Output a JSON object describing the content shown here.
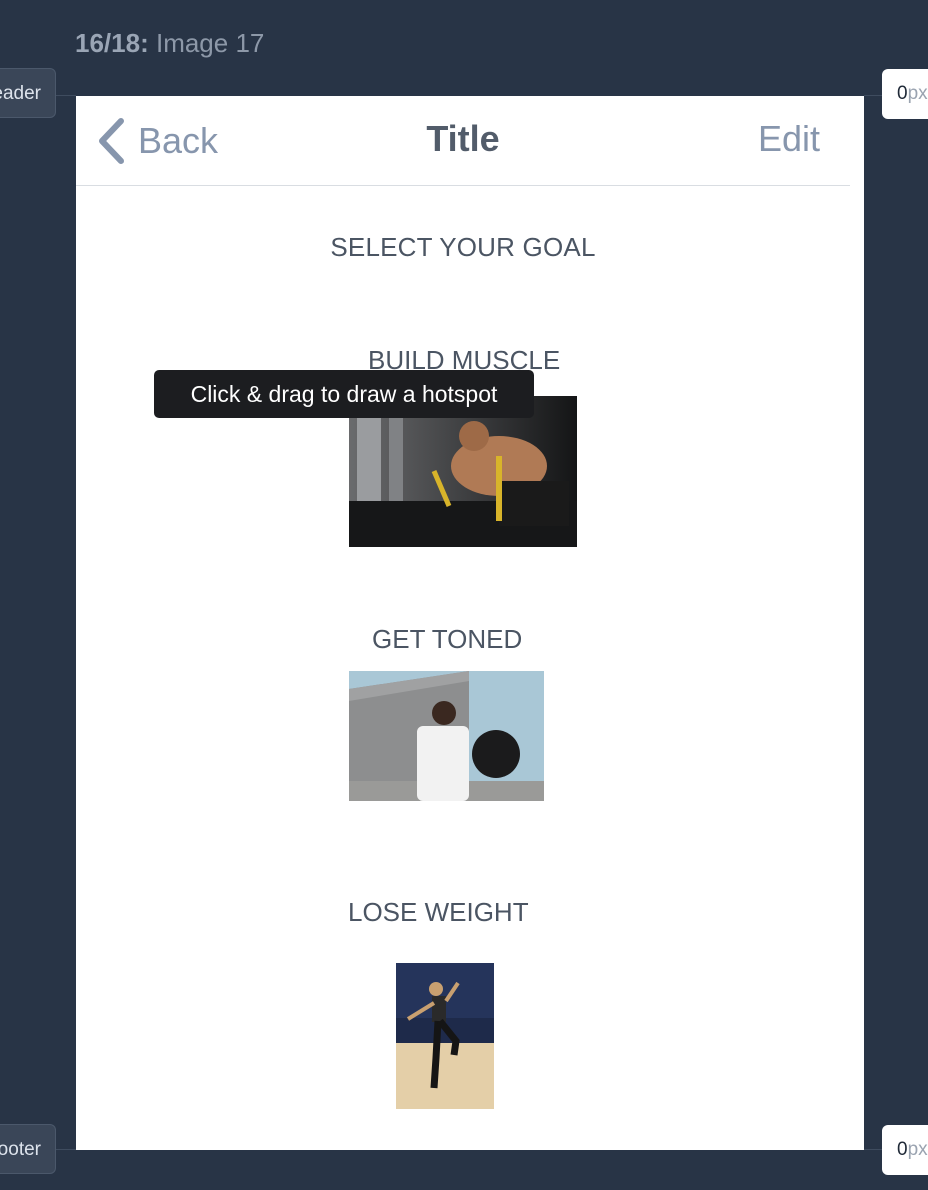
{
  "heading": {
    "counter": "16/18:",
    "name": "Image 17"
  },
  "side_tabs": {
    "header_label": "Header",
    "footer_label": "Footer",
    "top_offset": {
      "value": "0",
      "unit": "px"
    },
    "bottom_offset": {
      "value": "0",
      "unit": "px"
    }
  },
  "navbar": {
    "back_label": "Back",
    "title": "Title",
    "edit_label": "Edit"
  },
  "content": {
    "heading": "SELECT YOUR GOAL",
    "options": [
      {
        "label": "BUILD MUSCLE"
      },
      {
        "label": "GET TONED"
      },
      {
        "label": "LOSE WEIGHT"
      }
    ]
  },
  "tooltip": {
    "text": "Click & drag to draw a hotspot"
  },
  "icons": {
    "back": "chevron-left-icon"
  },
  "colors": {
    "background": "#283446",
    "screen": "#ffffff",
    "nav_link": "#8796ad",
    "tooltip": "#1c1d20"
  }
}
